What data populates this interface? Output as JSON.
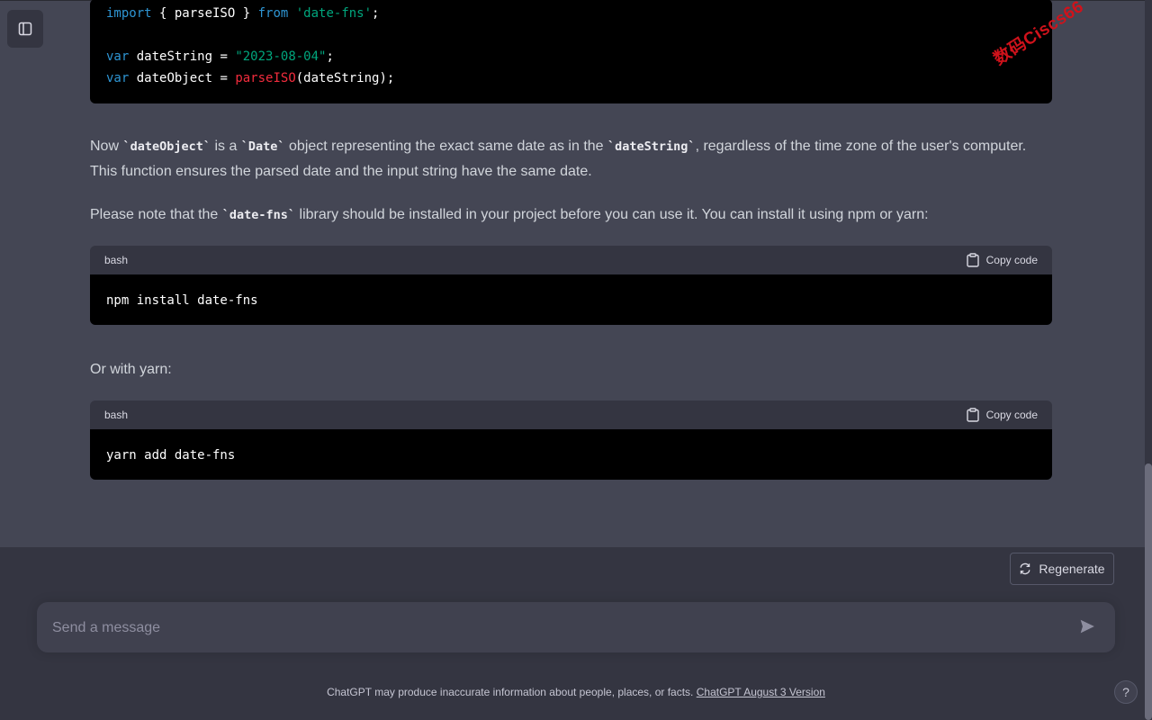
{
  "watermark": "数码Ciscs66",
  "code_blocks": [
    {
      "lines": [
        [
          {
            "t": "import",
            "c": "kw"
          },
          {
            "t": " { parseISO } "
          },
          {
            "t": "from",
            "c": "kw"
          },
          {
            "t": " "
          },
          {
            "t": "'date-fns'",
            "c": "str"
          },
          {
            "t": ";"
          }
        ],
        [],
        [
          {
            "t": "var",
            "c": "kw"
          },
          {
            "t": " dateString = "
          },
          {
            "t": "\"2023-08-04\"",
            "c": "str"
          },
          {
            "t": ";"
          }
        ],
        [
          {
            "t": "var",
            "c": "kw"
          },
          {
            "t": " dateObject = "
          },
          {
            "t": "parseISO",
            "c": "fn"
          },
          {
            "t": "(dateString);"
          }
        ]
      ]
    },
    {
      "language": "bash",
      "copy_label": "Copy code",
      "lines": [
        [
          {
            "t": "npm install date-fns"
          }
        ]
      ]
    },
    {
      "language": "bash",
      "copy_label": "Copy code",
      "lines": [
        [
          {
            "t": "yarn add date-fns"
          }
        ]
      ]
    }
  ],
  "paragraphs": {
    "p1": [
      {
        "text": "Now "
      },
      {
        "code": "`dateObject`"
      },
      {
        "text": " is a "
      },
      {
        "code": "`Date`"
      },
      {
        "text": " object representing the exact same date as in the "
      },
      {
        "code": "`dateString`"
      },
      {
        "text": ", regardless of the time zone of the user's computer. This function ensures the parsed date and the input string have the same date."
      }
    ],
    "p2": [
      {
        "text": "Please note that the "
      },
      {
        "code": "`date-fns`"
      },
      {
        "text": " library should be installed in your project before you can use it. You can install it using npm or yarn:"
      }
    ],
    "p3": [
      {
        "text": "Or with yarn:"
      }
    ]
  },
  "regenerate_label": "Regenerate",
  "composer": {
    "placeholder": "Send a message",
    "value": ""
  },
  "footer": {
    "note": "ChatGPT may produce inaccurate information about people, places, or facts. ",
    "link": "ChatGPT August 3 Version"
  },
  "help_label": "?",
  "icons": {
    "sidebar_toggle": "sidebar-toggle-icon",
    "copy": "clipboard-icon",
    "regenerate": "refresh-icon",
    "send": "send-icon"
  },
  "colors": {
    "background": "#444654",
    "code_header": "#343541",
    "code_body": "#000000",
    "keyword": "#2e95d3",
    "string": "#00a67d",
    "function": "#f22c3d"
  }
}
